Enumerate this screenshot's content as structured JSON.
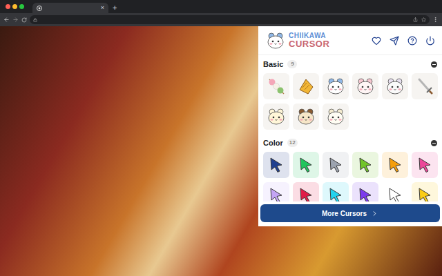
{
  "browser": {
    "tab": {
      "close": "×"
    },
    "new_tab": "+"
  },
  "popup": {
    "logo": {
      "line1": "CHIIKAWA",
      "line2": "CURSOR"
    },
    "sections": [
      {
        "title": "Basic",
        "count": "9",
        "expanded": true,
        "items": [
          {
            "kind": "dango"
          },
          {
            "kind": "bell"
          },
          {
            "kind": "hachiware"
          },
          {
            "kind": "chiikawa"
          },
          {
            "kind": "momonga"
          },
          {
            "kind": "sword"
          },
          {
            "kind": "usagi"
          },
          {
            "kind": "kurimanju"
          },
          {
            "kind": "rabbit"
          }
        ]
      },
      {
        "title": "Color",
        "count": "12",
        "expanded": true,
        "items": [
          {
            "kind": "arrow",
            "color": "#1f3f8f"
          },
          {
            "kind": "arrow",
            "color": "#22c55e"
          },
          {
            "kind": "arrow",
            "color": "#9ca3af"
          },
          {
            "kind": "arrow",
            "color": "#72c52a"
          },
          {
            "kind": "arrow",
            "color": "#f59e0b"
          },
          {
            "kind": "arrow",
            "color": "#ec4899"
          },
          {
            "kind": "arrow",
            "color": "#c4a5f5"
          },
          {
            "kind": "arrow",
            "color": "#e11d48"
          },
          {
            "kind": "arrow",
            "color": "#22d3ee"
          },
          {
            "kind": "arrow",
            "color": "#7c3aed"
          },
          {
            "kind": "arrow",
            "color": "#ffffff"
          },
          {
            "kind": "arrow",
            "color": "#facc15"
          }
        ]
      }
    ],
    "more_button": {
      "label": "More Cursors"
    }
  }
}
